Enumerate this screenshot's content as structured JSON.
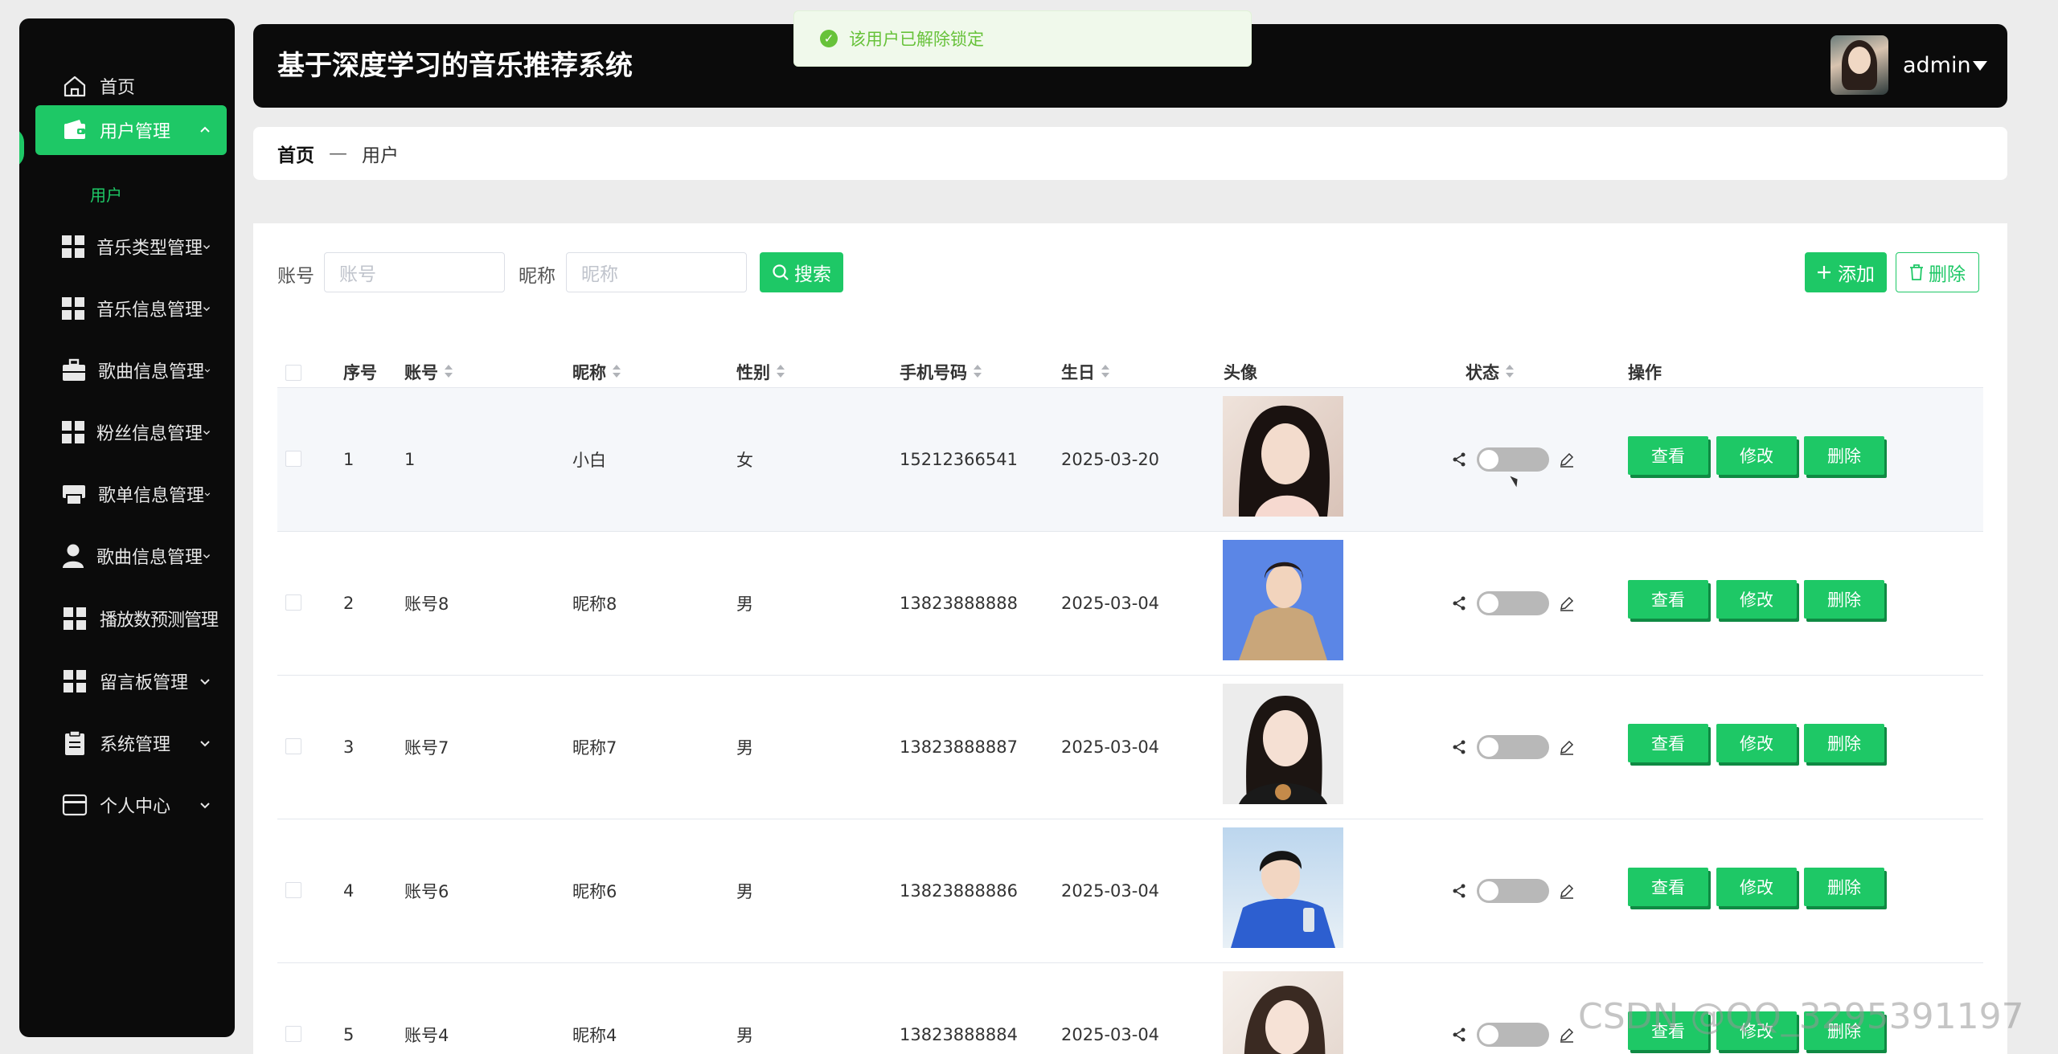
{
  "app": {
    "title": "基于深度学习的音乐推荐系统",
    "user": "admin"
  },
  "toast": {
    "message": "该用户已解除锁定"
  },
  "sidebar": {
    "items": [
      {
        "label": "首页",
        "icon": "home-icon"
      },
      {
        "label": "用户管理",
        "icon": "wallet-icon",
        "active": true
      },
      {
        "label": "音乐类型管理",
        "icon": "grid-icon"
      },
      {
        "label": "音乐信息管理",
        "icon": "grid-icon"
      },
      {
        "label": "歌曲信息管理",
        "icon": "briefcase-icon"
      },
      {
        "label": "粉丝信息管理",
        "icon": "grid-icon"
      },
      {
        "label": "歌单信息管理",
        "icon": "printer-icon"
      },
      {
        "label": "歌曲信息管理",
        "icon": "person-icon"
      },
      {
        "label": "播放数预测管理",
        "icon": "grid-icon"
      },
      {
        "label": "留言板管理",
        "icon": "grid-icon"
      },
      {
        "label": "系统管理",
        "icon": "clipboard-icon"
      },
      {
        "label": "个人中心",
        "icon": "card-icon"
      }
    ],
    "sub_item": "用户"
  },
  "breadcrumb": {
    "home": "首页",
    "separator": "—",
    "current": "用户"
  },
  "search": {
    "account_label": "账号",
    "account_placeholder": "账号",
    "nickname_label": "昵称",
    "nickname_placeholder": "昵称",
    "search_button": "搜索"
  },
  "toolbar": {
    "add_button": "添加",
    "delete_button": "删除"
  },
  "table": {
    "headers": {
      "index": "序号",
      "account": "账号",
      "nickname": "昵称",
      "gender": "性别",
      "phone": "手机号码",
      "birthday": "生日",
      "avatar": "头像",
      "status": "状态",
      "actions": "操作"
    },
    "rows": [
      {
        "index": "1",
        "account": "1",
        "nickname": "小白",
        "gender": "女",
        "phone": "15212366541",
        "birthday": "2025-03-20"
      },
      {
        "index": "2",
        "account": "账号8",
        "nickname": "昵称8",
        "gender": "男",
        "phone": "13823888888",
        "birthday": "2025-03-04"
      },
      {
        "index": "3",
        "account": "账号7",
        "nickname": "昵称7",
        "gender": "男",
        "phone": "13823888887",
        "birthday": "2025-03-04"
      },
      {
        "index": "4",
        "account": "账号6",
        "nickname": "昵称6",
        "gender": "男",
        "phone": "13823888886",
        "birthday": "2025-03-04"
      },
      {
        "index": "5",
        "account": "账号4",
        "nickname": "昵称4",
        "gender": "男",
        "phone": "13823888884",
        "birthday": "2025-03-04"
      }
    ],
    "action_labels": {
      "view": "查看",
      "edit": "修改",
      "delete": "删除"
    }
  },
  "watermark": "CSDN @QQ_3295391197",
  "colors": {
    "accent": "#1ec866",
    "sidebar_bg": "#0b0b0b"
  }
}
